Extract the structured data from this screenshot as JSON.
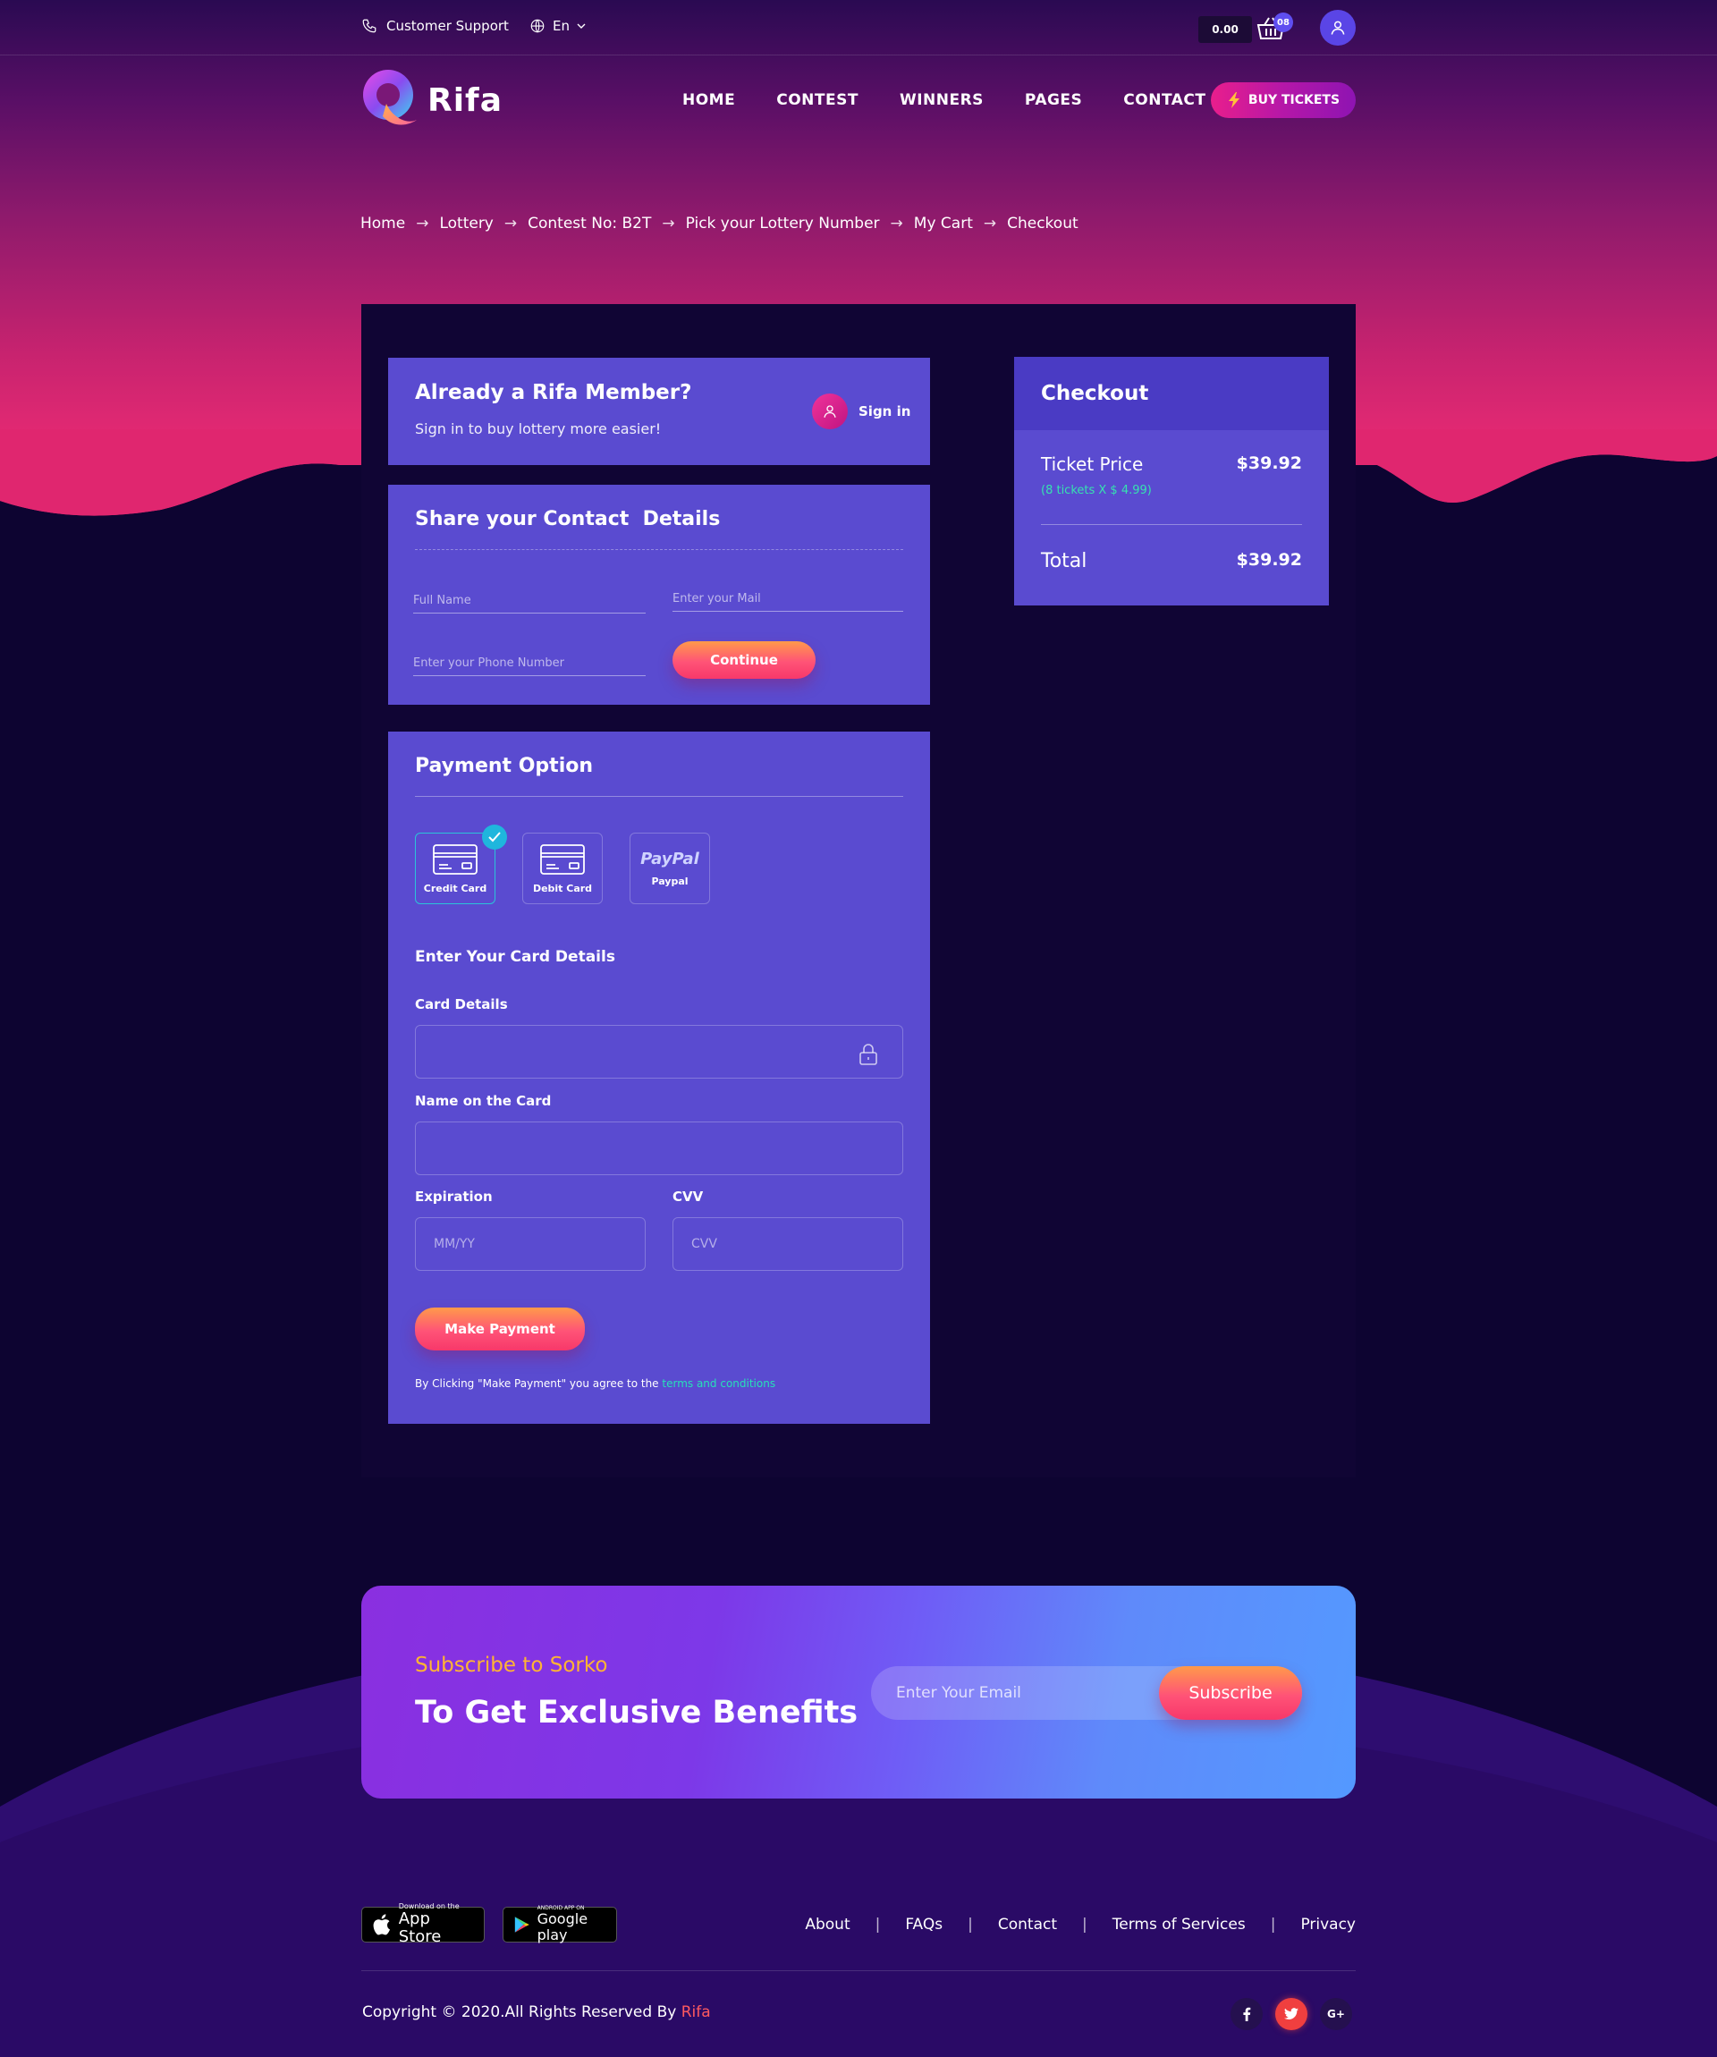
{
  "topbar": {
    "support_label": "Customer Support",
    "language": "En",
    "cart_amount": "0.00",
    "cart_count": "08"
  },
  "nav": {
    "brand": "Rifa",
    "links": [
      "HOME",
      "CONTEST",
      "WINNERS",
      "PAGES",
      "CONTACT"
    ],
    "buy_tickets": "BUY TICKETS"
  },
  "breadcrumb": [
    "Home",
    "Lottery",
    "Contest No: B2T",
    "Pick your Lottery Number",
    "My Cart",
    "Checkout"
  ],
  "member": {
    "title": "Already a Rifa Member?",
    "subtitle": "Sign in to buy lottery more easier!",
    "signin": "Sign in"
  },
  "contact": {
    "title": "Share your Contact  Details",
    "full_name_placeholder": "Full Name",
    "email_placeholder": "Enter your Mail",
    "phone_placeholder": "Enter your Phone Number",
    "continue": "Continue"
  },
  "payment": {
    "title": "Payment Option",
    "options": [
      {
        "label": "Credit Card",
        "icon": "credit-card-icon",
        "selected": true
      },
      {
        "label": "Debit Card",
        "icon": "debit-card-icon",
        "selected": false
      },
      {
        "label": "Paypal",
        "icon": "paypal-icon",
        "selected": false,
        "logo_text": "PayPal"
      }
    ],
    "card_section_title": "Enter Your Card Details",
    "card_details_label": "Card Details",
    "card_details_value": "",
    "name_label": "Name on the Card",
    "name_value": "",
    "expiration_label": "Expiration",
    "expiration_placeholder": "MM/YY",
    "cvv_label": "CVV",
    "cvv_placeholder": "CVV",
    "make_payment": "Make Payment",
    "terms_prefix": "By Clicking \"Make Payment\" you agree to the ",
    "terms_link": "terms and conditions"
  },
  "checkout": {
    "title": "Checkout",
    "ticket_price_label": "Ticket Price",
    "ticket_price_value": "$39.92",
    "ticket_note": "(8 tickets X $ 4.99)",
    "total_label": "Total",
    "total_value": "$39.92"
  },
  "subscribe": {
    "small": "Subscribe to Sorko",
    "big": "To Get Exclusive Benefits",
    "email_placeholder": "Enter Your Email",
    "button": "Subscribe"
  },
  "footer": {
    "app_store_small": "Download on the",
    "app_store_big": "App Store",
    "google_small": "ANDROID APP ON",
    "google_big": "Google play",
    "links": [
      "About",
      "FAQs",
      "Contact",
      "Terms of Services",
      "Privacy"
    ],
    "copyright_prefix": "Copyright © 2020.All Rights Reserved By ",
    "copyright_brand": "Rifa",
    "socials": [
      "f",
      "t",
      "G+"
    ]
  },
  "colors": {
    "card_bg": "#5a4bd0",
    "panel_bg": "#100534",
    "accent_pink": "#e91e8c",
    "accent_teal": "#27e0b8",
    "accent_orange": "#ffb433"
  }
}
